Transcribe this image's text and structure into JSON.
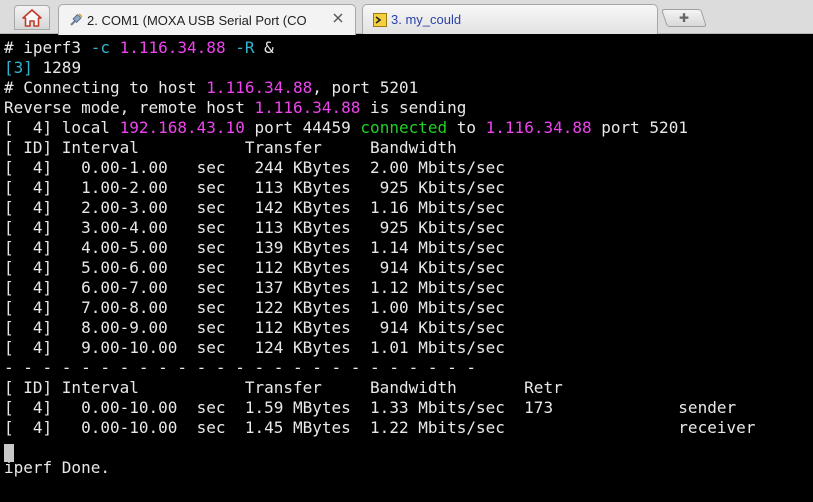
{
  "tabs": [
    {
      "label": "2. COM1  (MOXA USB Serial Port (CO",
      "icon": "serial-plug-icon",
      "active": true
    },
    {
      "label": "3. my_could",
      "icon": "ssh-terminal-icon",
      "active": false
    }
  ],
  "colors": {
    "background": "#000000",
    "text": "#e8e8e8",
    "magenta": "#ee44ee",
    "green": "#22d022",
    "cyan": "#2fb3ce"
  },
  "terminal": {
    "lines": [
      {
        "segments": [
          {
            "text": "# iperf3 "
          },
          {
            "text": "-c",
            "color": "cyan"
          },
          {
            "text": " "
          },
          {
            "text": "1.116.34.88",
            "color": "magenta"
          },
          {
            "text": " "
          },
          {
            "text": "-R",
            "color": "cyan"
          },
          {
            "text": " &"
          }
        ]
      },
      {
        "segments": [
          {
            "text": "[3]",
            "color": "cyan"
          },
          {
            "text": " 1289"
          }
        ]
      },
      {
        "segments": [
          {
            "text": "# Connecting to host "
          },
          {
            "text": "1.116.34.88",
            "color": "magenta"
          },
          {
            "text": ", port 5201"
          }
        ]
      },
      {
        "segments": [
          {
            "text": "Reverse mode, remote host "
          },
          {
            "text": "1.116.34.88",
            "color": "magenta"
          },
          {
            "text": " is sending"
          }
        ]
      },
      {
        "segments": [
          {
            "text": "[  4] local "
          },
          {
            "text": "192.168.43.10",
            "color": "magenta"
          },
          {
            "text": " port 44459 "
          },
          {
            "text": "connected",
            "color": "green"
          },
          {
            "text": " to "
          },
          {
            "text": "1.116.34.88",
            "color": "magenta"
          },
          {
            "text": " port 5201"
          }
        ]
      },
      {
        "segments": [
          {
            "text": "[ ID] Interval           Transfer     Bandwidth"
          }
        ]
      },
      {
        "segments": [
          {
            "text": "[  4]   0.00-1.00   sec   244 KBytes  2.00 Mbits/sec"
          }
        ]
      },
      {
        "segments": [
          {
            "text": "[  4]   1.00-2.00   sec   113 KBytes   925 Kbits/sec"
          }
        ]
      },
      {
        "segments": [
          {
            "text": "[  4]   2.00-3.00   sec   142 KBytes  1.16 Mbits/sec"
          }
        ]
      },
      {
        "segments": [
          {
            "text": "[  4]   3.00-4.00   sec   113 KBytes   925 Kbits/sec"
          }
        ]
      },
      {
        "segments": [
          {
            "text": "[  4]   4.00-5.00   sec   139 KBytes  1.14 Mbits/sec"
          }
        ]
      },
      {
        "segments": [
          {
            "text": "[  4]   5.00-6.00   sec   112 KBytes   914 Kbits/sec"
          }
        ]
      },
      {
        "segments": [
          {
            "text": "[  4]   6.00-7.00   sec   137 KBytes  1.12 Mbits/sec"
          }
        ]
      },
      {
        "segments": [
          {
            "text": "[  4]   7.00-8.00   sec   122 KBytes  1.00 Mbits/sec"
          }
        ]
      },
      {
        "segments": [
          {
            "text": "[  4]   8.00-9.00   sec   112 KBytes   914 Kbits/sec"
          }
        ]
      },
      {
        "segments": [
          {
            "text": "[  4]   9.00-10.00  sec   124 KBytes  1.01 Mbits/sec"
          }
        ]
      },
      {
        "segments": [
          {
            "text": "- - - - - - - - - - - - - - - - - - - - - - - - -"
          }
        ]
      },
      {
        "segments": [
          {
            "text": "[ ID] Interval           Transfer     Bandwidth       Retr"
          }
        ]
      },
      {
        "segments": [
          {
            "text": "[  4]   0.00-10.00  sec  1.59 MBytes  1.33 Mbits/sec  173             sender"
          }
        ]
      },
      {
        "segments": [
          {
            "text": "[  4]   0.00-10.00  sec  1.45 MBytes  1.22 Mbits/sec                  receiver"
          }
        ]
      },
      {
        "segments": [
          {
            "text": ""
          }
        ]
      },
      {
        "segments": [
          {
            "text": "iperf Done."
          }
        ]
      }
    ]
  }
}
